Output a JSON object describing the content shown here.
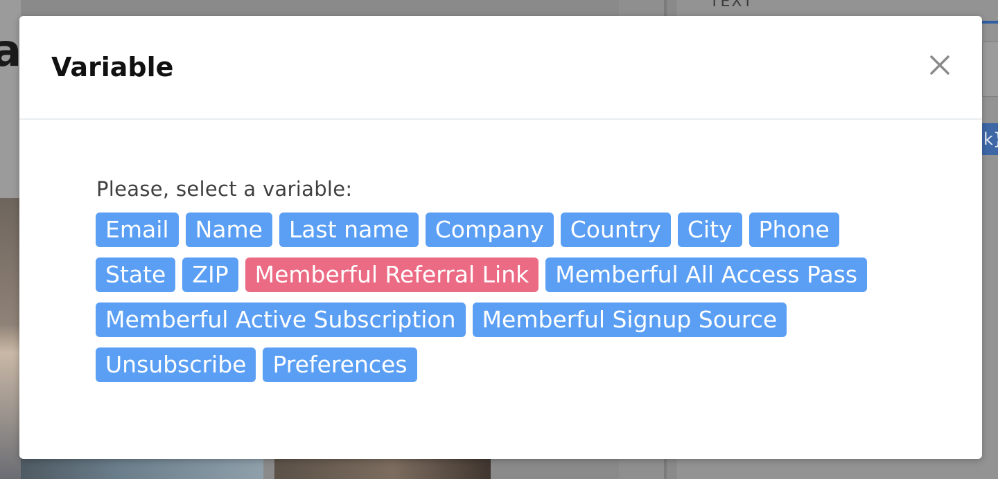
{
  "background": {
    "logo_fragment": "a",
    "panel_label": "TEXT",
    "chip_fragment": "k}"
  },
  "modal": {
    "title": "Variable",
    "close_icon": "close-icon",
    "prompt": "Please, select a variable:",
    "colors": {
      "chip": "#5b9ff5",
      "chip_active": "#ec6b84"
    },
    "rows": [
      [
        {
          "label": "Email",
          "active": false
        },
        {
          "label": "Name",
          "active": false
        },
        {
          "label": "Last name",
          "active": false
        },
        {
          "label": "Company",
          "active": false
        },
        {
          "label": "Country",
          "active": false
        },
        {
          "label": "City",
          "active": false
        },
        {
          "label": "Phone",
          "active": false
        }
      ],
      [
        {
          "label": "State",
          "active": false
        },
        {
          "label": "ZIP",
          "active": false
        },
        {
          "label": "Memberful Referral Link",
          "active": true
        },
        {
          "label": "Memberful All Access Pass",
          "active": false
        }
      ],
      [
        {
          "label": "Memberful Active Subscription",
          "active": false
        },
        {
          "label": "Memberful Signup Source",
          "active": false
        }
      ],
      [
        {
          "label": "Unsubscribe",
          "active": false
        },
        {
          "label": "Preferences",
          "active": false
        }
      ]
    ]
  }
}
